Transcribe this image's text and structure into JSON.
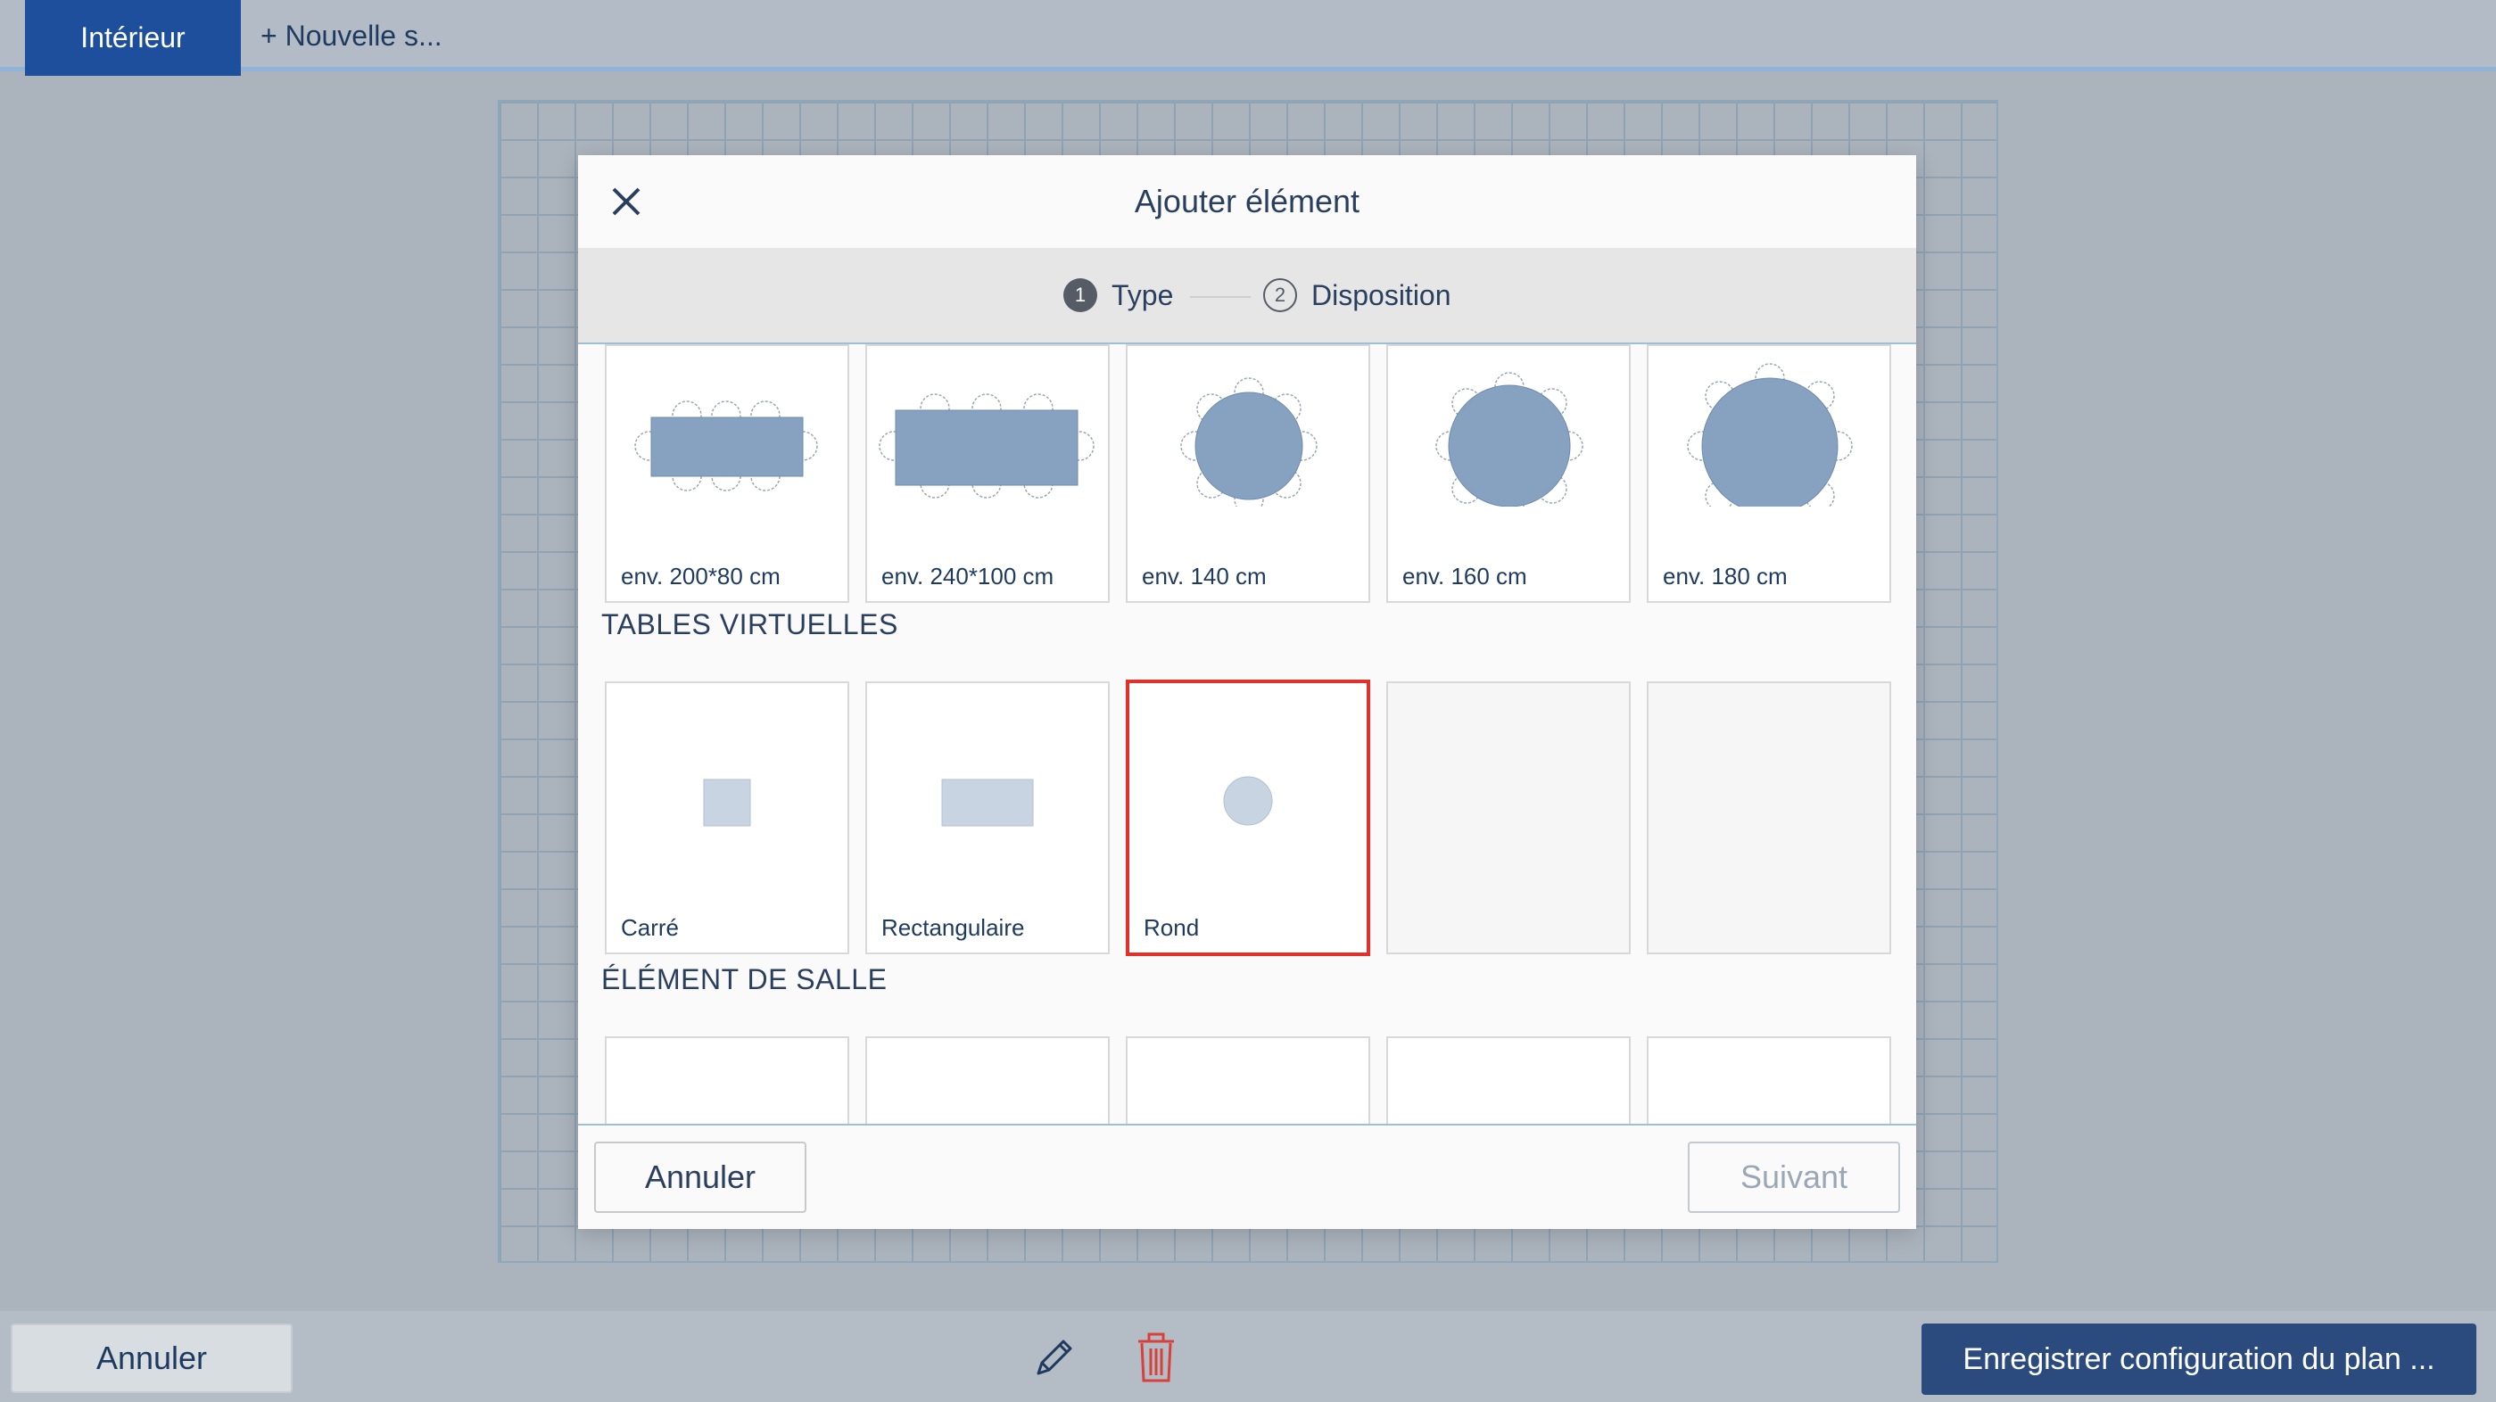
{
  "tabs": {
    "active": "Intérieur",
    "new": "+ Nouvelle s..."
  },
  "modal": {
    "title": "Ajouter élément",
    "steps": [
      {
        "number": "1",
        "label": "Type"
      },
      {
        "number": "2",
        "label": "Disposition"
      }
    ],
    "tables": [
      {
        "label": "env. 200*80 cm"
      },
      {
        "label": "env. 240*100 cm"
      },
      {
        "label": "env. 140 cm"
      },
      {
        "label": "env. 160 cm"
      },
      {
        "label": "env. 180 cm"
      }
    ],
    "virtual_title": "TABLES VIRTUELLES",
    "virtual": [
      {
        "label": "Carré"
      },
      {
        "label": "Rectangulaire"
      },
      {
        "label": "Rond",
        "selected": true
      }
    ],
    "room_title": "ÉLÉMENT DE SALLE",
    "cancel": "Annuler",
    "next": "Suivant"
  },
  "bottom": {
    "cancel": "Annuler",
    "save": "Enregistrer configuration du plan ...",
    "icons": [
      "pencil-icon",
      "trash-icon"
    ]
  },
  "colors": {
    "accent": "#1e4f9c",
    "table_fill": "#87a1c0",
    "virtual_fill": "#c9d4e2",
    "selected_border": "#e0312b",
    "delete_icon": "#d9403a"
  }
}
